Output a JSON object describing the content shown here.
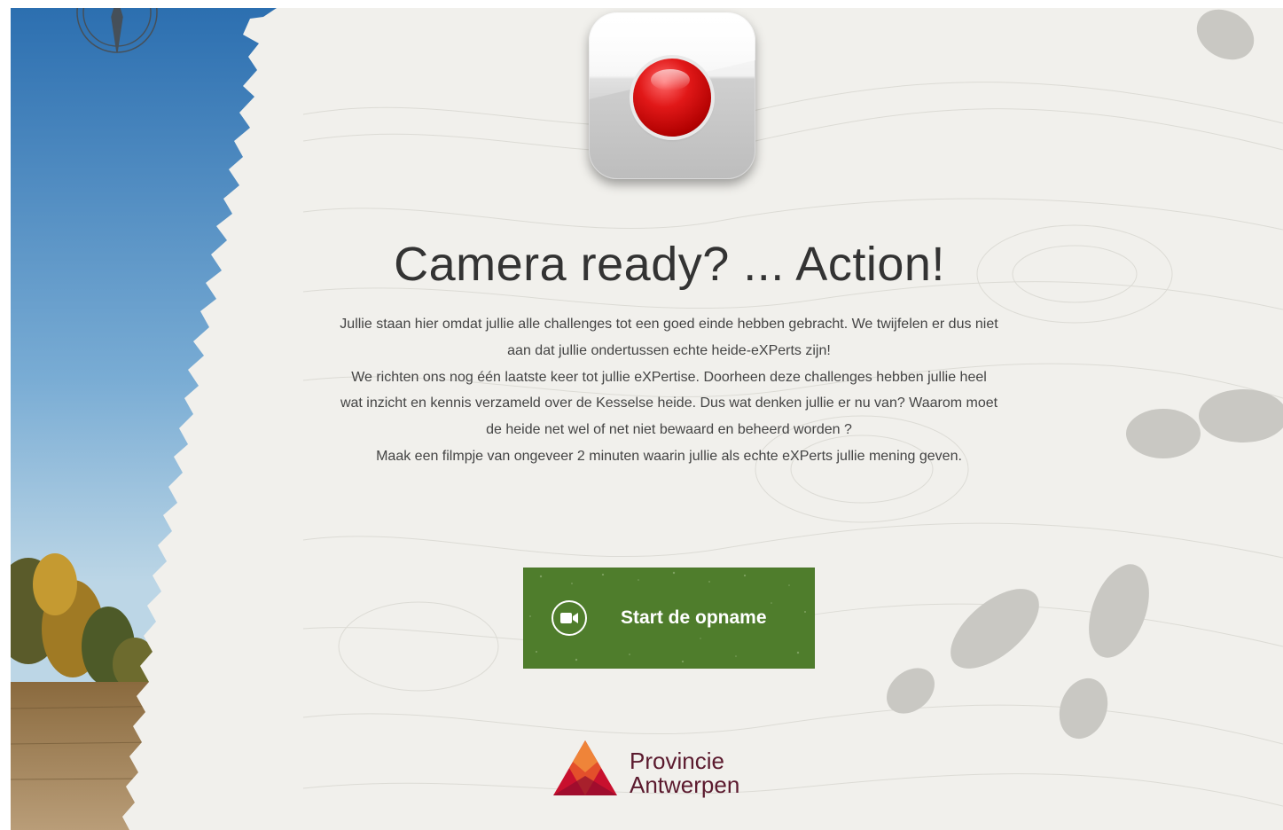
{
  "hero": {
    "icon": "record-button-icon",
    "title": "Camera ready? ... Action!"
  },
  "intro": {
    "paragraphs": [
      "Jullie staan hier omdat jullie alle challenges tot een goed einde hebben gebracht. We twijfelen er dus niet aan dat jullie ondertussen echte heide-eXPerts zijn!",
      "We richten ons nog één laatste keer tot jullie eXPertise. Doorheen deze challenges hebben jullie heel wat inzicht en kennis verzameld over de Kesselse heide. Dus wat denken jullie er nu van? Waarom moet de heide net wel of net niet bewaard en beheerd worden ?",
      "Maak een filmpje van ongeveer 2 minuten waarin jullie als echte eXPerts jullie mening geven."
    ]
  },
  "actions": {
    "start_label": "Start de opname",
    "start_icon": "video-camera-icon",
    "button_color": "#4f7d2c"
  },
  "footer": {
    "logo_line1": "Provincie",
    "logo_line2": "Antwerpen",
    "logo_color": "#5b1a2e"
  },
  "decor": {
    "left_panel": "heathland-landscape-photo",
    "compass": "compass-rose-icon",
    "footprints": "footprint-icon"
  }
}
